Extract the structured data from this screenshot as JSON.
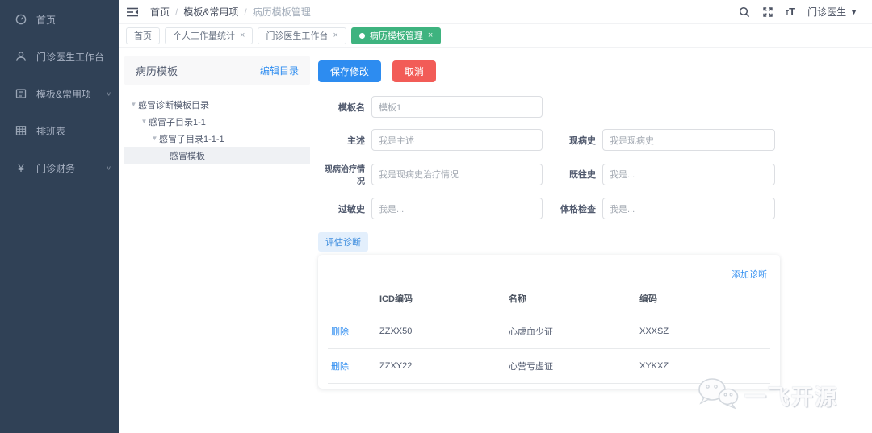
{
  "colors": {
    "sidebar_bg": "#304156",
    "primary_blue": "#2d8cf0",
    "danger_red": "#f25c57",
    "active_tab_green": "#3eb37f",
    "panel_header_bg": "#f8f8f9"
  },
  "sidebar": {
    "items": [
      {
        "label": "首页",
        "icon": "dashboard-icon",
        "has_arrow": false
      },
      {
        "label": "门诊医生工作台",
        "icon": "doctor-user-icon",
        "has_arrow": false
      },
      {
        "label": "模板&常用项",
        "icon": "template-list-icon",
        "has_arrow": true
      },
      {
        "label": "排班表",
        "icon": "schedule-grid-icon",
        "has_arrow": false
      },
      {
        "label": "门诊财务",
        "icon": "finance-yuan-icon",
        "has_arrow": true
      }
    ],
    "arrow_glyph": "∨"
  },
  "header": {
    "breadcrumb": {
      "0": "首页",
      "1": "模板&常用项",
      "2": "病历模板管理"
    },
    "separator": "/",
    "user_name": "门诊医生",
    "caret": "▼",
    "font_icon_small": "т",
    "font_icon_big": "T"
  },
  "tabs": {
    "0": {
      "label": "首页"
    },
    "1": {
      "label": "个人工作量统计",
      "close": "×"
    },
    "2": {
      "label": "门诊医生工作台",
      "close": "×"
    },
    "3": {
      "label": "病历模板管理",
      "close": "×"
    }
  },
  "panel": {
    "title": "病历模板",
    "edit_link": "编辑目录",
    "arrow_glyph": "▼",
    "tree": {
      "0": {
        "label": "感冒诊断模板目录"
      },
      "1": {
        "label": "感冒子目录1-1"
      },
      "2": {
        "label": "感冒子目录1-1-1"
      },
      "3": {
        "label": "感冒模板"
      }
    }
  },
  "form": {
    "save_button": "保存修改",
    "cancel_button": "取消",
    "fields": {
      "template_name": {
        "label": "模板名",
        "value": "模板1"
      },
      "chief_complaint": {
        "label": "主述",
        "value": "我是主述"
      },
      "present_illness": {
        "label": "现病史",
        "value": "我是现病史"
      },
      "treatment": {
        "label": "现病治疗情况",
        "value": "我是现病史治疗情况"
      },
      "past_history": {
        "label": "既往史",
        "value": "我是..."
      },
      "allergy": {
        "label": "过敏史",
        "value": "我是..."
      },
      "physical_exam": {
        "label": "体格检查",
        "value": "我是..."
      }
    },
    "diagnosis_tab": "评估诊断",
    "add_link": "添加诊断",
    "table": {
      "action_label": "删除",
      "headers": {
        "0": "ICD编码",
        "1": "名称",
        "2": "编码"
      },
      "rows": {
        "0": {
          "icd": "ZZXX50",
          "name": "心虚血少证",
          "code": "XXXSZ"
        },
        "1": {
          "icd": "ZZXY22",
          "name": "心营亏虚证",
          "code": "XYKXZ"
        }
      }
    }
  },
  "watermark": {
    "text": "一飞开源"
  }
}
